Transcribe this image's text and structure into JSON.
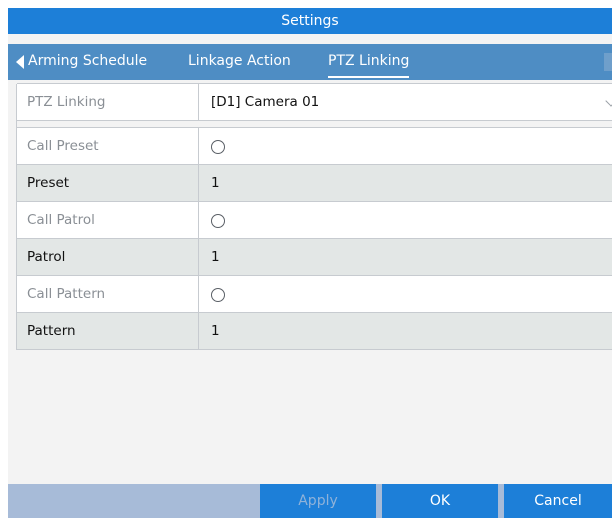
{
  "window": {
    "title": "Settings"
  },
  "tabs": [
    {
      "label": "Arming Schedule",
      "active": false
    },
    {
      "label": "Linkage Action",
      "active": false
    },
    {
      "label": "PTZ Linking",
      "active": true
    }
  ],
  "form": {
    "ptz_linking": {
      "label": "PTZ Linking",
      "value": "[D1] Camera 01"
    },
    "call_preset": {
      "label": "Call Preset",
      "checked": false
    },
    "preset": {
      "label": "Preset",
      "value": "1"
    },
    "call_patrol": {
      "label": "Call Patrol",
      "checked": false
    },
    "patrol": {
      "label": "Patrol",
      "value": "1"
    },
    "call_pattern": {
      "label": "Call Pattern",
      "checked": false
    },
    "pattern": {
      "label": "Pattern",
      "value": "1"
    }
  },
  "buttons": {
    "apply": "Apply",
    "ok": "OK",
    "cancel": "Cancel"
  },
  "colors": {
    "title_bar": "#1d7fd8",
    "tab_bar": "#4e8dc4",
    "footer": "#a7bbd8",
    "button": "#1d7fd8"
  }
}
